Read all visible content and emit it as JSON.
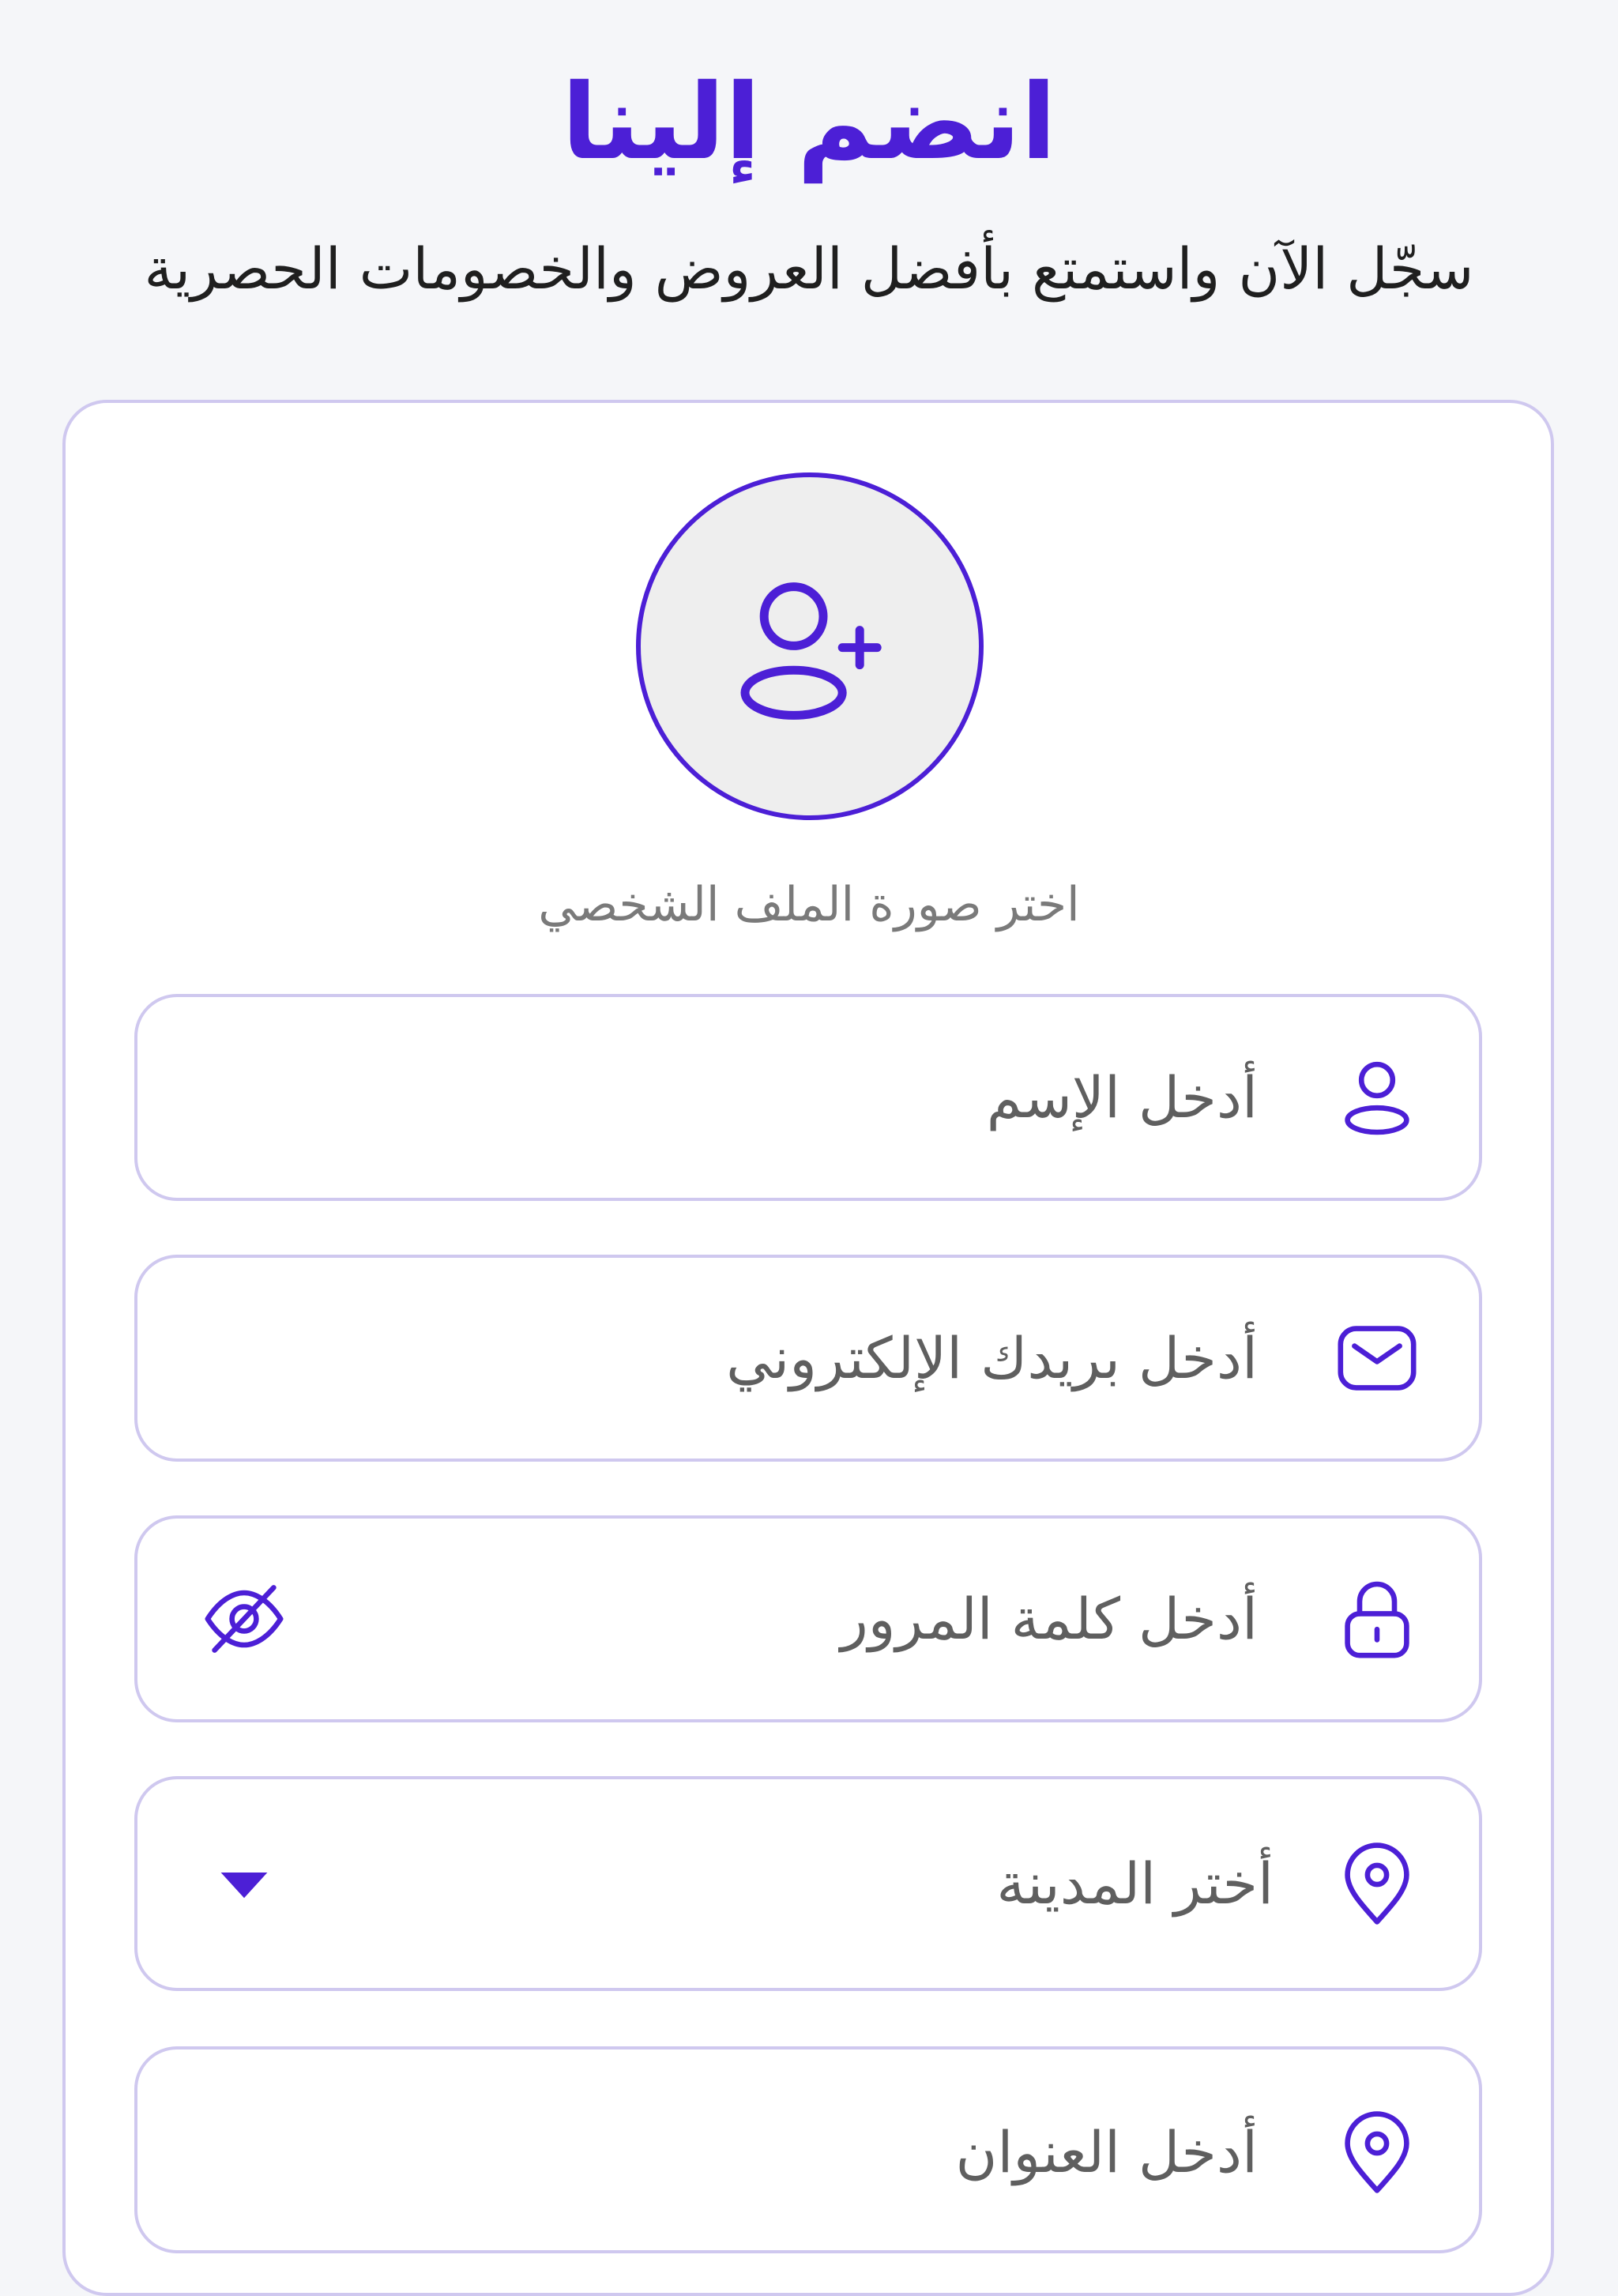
{
  "header": {
    "title": "انضم إلينا",
    "subtitle": "سجّل الآن واستمتع بأفضل العروض والخصومات الحصرية"
  },
  "avatar": {
    "label": "اختر صورة الملف الشخصي",
    "icon": "user-plus-icon"
  },
  "fields": {
    "name": {
      "placeholder": "أدخل الإسم",
      "icon": "user-icon"
    },
    "email": {
      "placeholder": "أدخل بريدك الإلكتروني",
      "icon": "mail-icon"
    },
    "password": {
      "placeholder": "أدخل كلمة المرور",
      "icon": "lock-icon",
      "toggle_icon": "eye-off-icon"
    },
    "city": {
      "placeholder": "أختر المدينة",
      "icon": "location-pin-icon",
      "dropdown_icon": "caret-down-icon"
    },
    "address": {
      "placeholder": "أدخل العنوان",
      "icon": "location-pin-icon"
    }
  },
  "colors": {
    "accent": "#4c1fd6",
    "border": "#cfc8ef",
    "background": "#f5f6f9"
  }
}
